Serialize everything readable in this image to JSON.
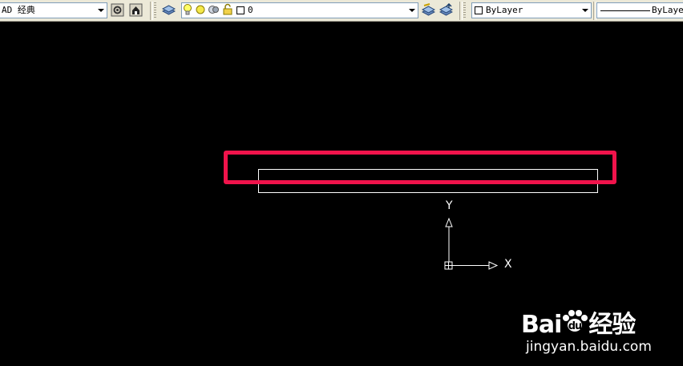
{
  "toolbar": {
    "workspace": {
      "value": "AD 经典"
    },
    "layer": {
      "value": "0"
    },
    "color": {
      "value": "ByLayer"
    },
    "linetype": {
      "value": "ByLayer"
    }
  },
  "canvas": {
    "ucs": {
      "y_label": "Y",
      "x_label": "X"
    }
  },
  "watermark": {
    "brand_lead": "Bai",
    "brand_tail": "经验",
    "url": "jingyan.baidu.com"
  },
  "colors": {
    "background": "#000000",
    "toolbar": "#ece9d8",
    "highlight": "#f0134b",
    "geometry": "#ffffff"
  },
  "icons": [
    "workspace-settings-icon",
    "customize-icon",
    "layer-manager-icon",
    "lightbulb-icon",
    "sun-icon",
    "layer-freeze-icon",
    "lock-icon",
    "make-current-icon",
    "layer-previous-icon",
    "ucs-icon",
    "paw-icon"
  ]
}
